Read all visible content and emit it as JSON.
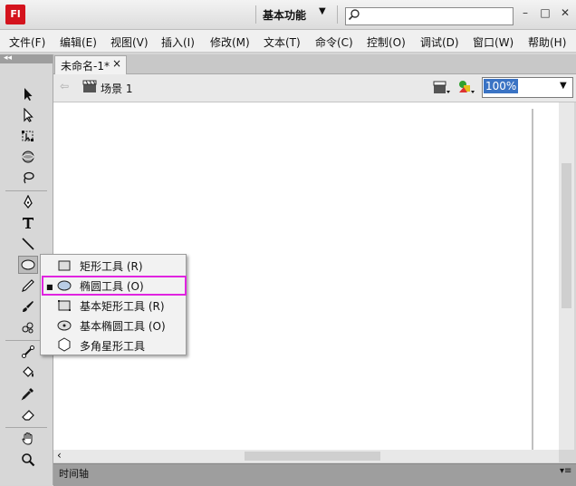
{
  "titlebar": {
    "logo": "Fl",
    "workspace": "基本功能",
    "search": {
      "placeholder": "",
      "value": ""
    }
  },
  "menu": [
    {
      "label": "文件(F)"
    },
    {
      "label": "编辑(E)"
    },
    {
      "label": "视图(V)"
    },
    {
      "label": "插入(I)"
    },
    {
      "label": "修改(M)"
    },
    {
      "label": "文本(T)"
    },
    {
      "label": "命令(C)"
    },
    {
      "label": "控制(O)"
    },
    {
      "label": "调试(D)"
    },
    {
      "label": "窗口(W)"
    },
    {
      "label": "帮助(H)"
    }
  ],
  "document": {
    "tab_label": "未命名-1*",
    "close_glyph": "×"
  },
  "scene": {
    "label": "场景 1",
    "zoom": "100%"
  },
  "timeline": {
    "label": "时间轴"
  },
  "flyout": {
    "items": [
      {
        "label": "矩形工具 (R)",
        "icon": "rectangle-icon"
      },
      {
        "label": "椭圆工具 (O)",
        "icon": "oval-icon",
        "selected": true
      },
      {
        "label": "基本矩形工具 (R)",
        "icon": "primitive-rectangle-icon"
      },
      {
        "label": "基本椭圆工具 (O)",
        "icon": "primitive-oval-icon"
      },
      {
        "label": "多角星形工具",
        "icon": "polystar-icon"
      }
    ]
  },
  "colors": {
    "highlight": "#e024e0",
    "logo": "#d4131d",
    "zoom_selection": "#3a73c4"
  }
}
